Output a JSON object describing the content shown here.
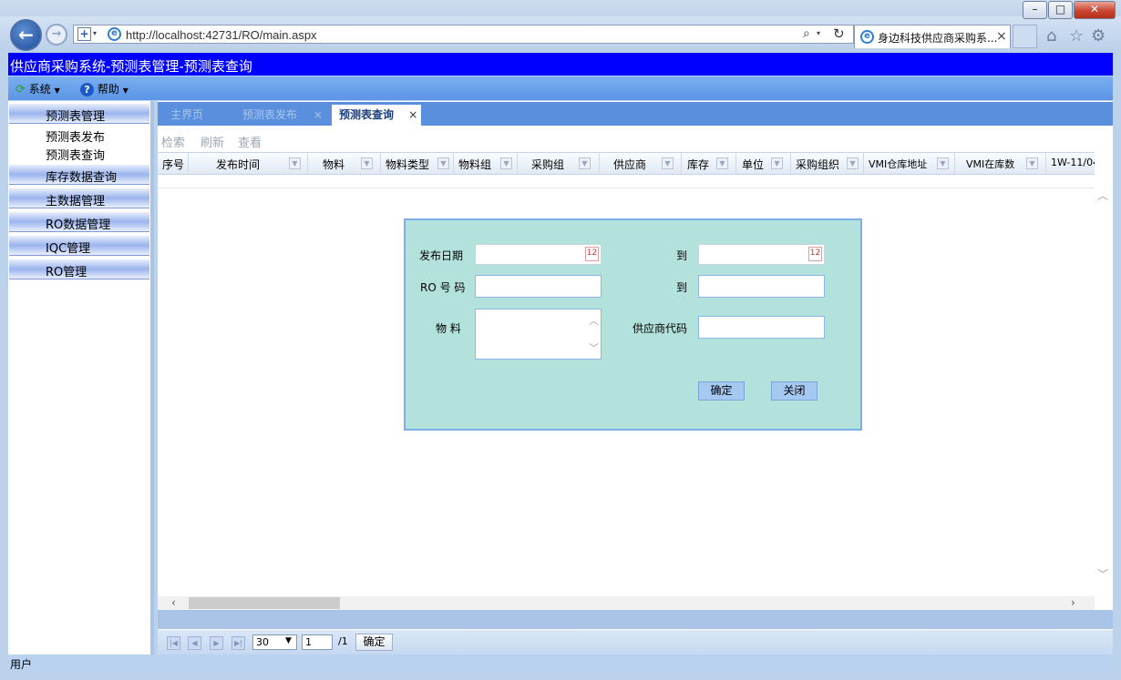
{
  "browser": {
    "url": "http://localhost:42731/RO/main.aspx",
    "tab_title": "身边科技供应商采购系...",
    "tab_close": "×",
    "colors": {
      "frame": "#c3d3ea",
      "close": "#c9442f"
    }
  },
  "app": {
    "title": "供应商采购系统-预测表管理-预测表查询",
    "title_bg": "#0000ff",
    "menu": [
      {
        "label": "系统",
        "icon": "refresh-icon"
      },
      {
        "label": "帮助",
        "icon": "help-icon"
      }
    ]
  },
  "sidebar": {
    "groups": [
      {
        "label": "预测表管理",
        "items": [
          "预测表发布",
          "预测表查询"
        ]
      },
      {
        "label": "库存数据查询"
      },
      {
        "label": "主数据管理"
      },
      {
        "label": "RO数据管理"
      },
      {
        "label": "IQC管理"
      },
      {
        "label": "RO管理"
      }
    ]
  },
  "tabs": [
    {
      "label": "主界页",
      "active": false
    },
    {
      "label": "预测表发布",
      "active": false,
      "close": "×"
    },
    {
      "label": "预测表查询",
      "active": true,
      "close": "×"
    }
  ],
  "toolbar": {
    "search": "检索",
    "refresh": "刷新",
    "view": "查看"
  },
  "grid": {
    "columns": [
      "序号",
      "发布时间",
      "物料",
      "物料类型",
      "物料组",
      "采购组",
      "供应商",
      "库存",
      "单位",
      "采购组织",
      "VMI仓库地址",
      "VMI在库数",
      "1W-11/04"
    ]
  },
  "pager": {
    "page_size": "30",
    "page": "1",
    "total": "/1",
    "go": "确定"
  },
  "status": "用户",
  "dialog": {
    "publish_date_label": "发布日期",
    "to_label": "到",
    "ro_number_label": "RO 号 码",
    "material_label": "物 料",
    "supplier_code_label": "供应商代码",
    "confirm": "确定",
    "close": "关闭",
    "bg": "#b3e1db"
  }
}
